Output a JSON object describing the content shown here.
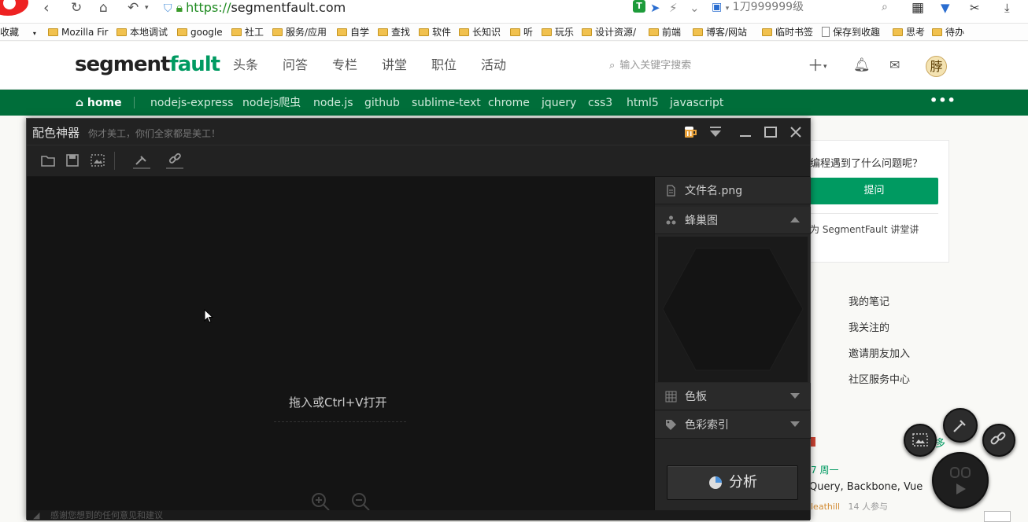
{
  "browser": {
    "url_scheme": "https://",
    "url_host": "segmentfault.com",
    "search_text": "1刀999999级",
    "bookmarks_label": "收藏",
    "bookmarks": [
      "Mozilla Fir",
      "本地调试",
      "google",
      "社工",
      "服务/应用",
      "自学",
      "查找",
      "软件",
      "长知识",
      "听",
      "玩乐",
      "设计资源/",
      "前端",
      "博客/网站",
      "临时书签",
      "保存到收趣",
      "思考",
      "待办"
    ]
  },
  "site": {
    "logo_part1": "segment",
    "logo_part2": "fault",
    "nav": [
      "头条",
      "问答",
      "专栏",
      "讲堂",
      "职位",
      "活动"
    ],
    "search_placeholder": "输入关键字搜索",
    "avatar_char": "脖",
    "tags": [
      "home",
      "nodejs-express",
      "nodejs爬虫",
      "node.js",
      "github",
      "sublime-text",
      "chrome",
      "jquery",
      "css3",
      "html5",
      "javascript"
    ],
    "sidebar": {
      "question": "编程遇到了什么问题呢？",
      "ask_button": "提问",
      "promo": "为 SegmentFault 讲堂讲",
      "links": [
        "我的笔记",
        "我关注的",
        "邀请朋友加入",
        "社区服务中心"
      ],
      "more": "多",
      "event_date": "7 周一",
      "event_title": "Query, Backbone, Vue",
      "event_author": "leathill",
      "event_participants": "14 人参与"
    }
  },
  "app": {
    "title": "配色神器",
    "slogan": "你才美工，你们全家都是美工！",
    "drop_hint": "拖入或Ctrl+V打开",
    "status": "感谢您想到的任何意见和建议",
    "panel": {
      "filename": "文件名.png",
      "hive_label": "蜂巢图",
      "swatch_label": "色板",
      "index_label": "色彩索引",
      "analyze_label": "分析"
    },
    "colors": {
      "accent_green": "#009a61",
      "tagbar": "#006e3a",
      "app_bg": "#141414"
    }
  }
}
